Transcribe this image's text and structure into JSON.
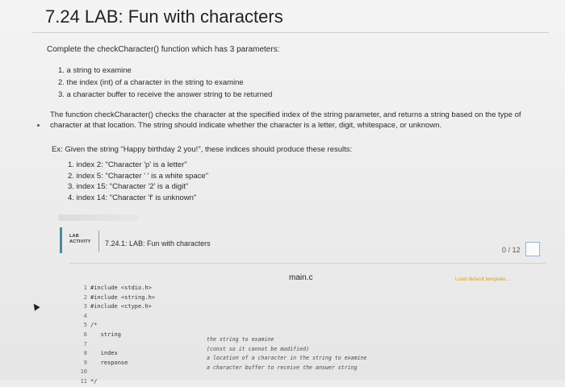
{
  "page_title": "7.24 LAB: Fun with characters",
  "instructions": {
    "intro": "Complete the checkCharacter() function which has 3 parameters:",
    "parameters": [
      "1. a string to examine",
      "2. the index (int) of a character in the string to examine",
      "3. a character buffer to receive the answer string to be returned"
    ],
    "description_lines": [
      "The function checkCharacter() checks the character at the specified index of the string parameter, and returns a string based on the type of",
      "character at that location. The string should indicate whether the character is a letter, digit, whitespace, or unknown."
    ],
    "example_intro": "Ex: Given the string \"Happy birthday 2 you!\", these indices should produce these results:",
    "examples": [
      "1. index 2: \"Character 'p' is a letter\"",
      "2. index 5: \"Character ' ' is a white space\"",
      "3. index 15: \"Character '2' is a digit\"",
      "4. index 14: \"Character 'f' is unknown\""
    ]
  },
  "activity": {
    "tag_line1": "LAB",
    "tag_line2": "ACTIVITY",
    "title": "7.24.1: LAB: Fun with characters",
    "score": "0 / 12",
    "filename": "main.c",
    "load_template_label": "Load default template..."
  },
  "code": {
    "lines": [
      {
        "num": "1",
        "text": "#include <stdio.h>"
      },
      {
        "num": "2",
        "text": "#include <string.h>"
      },
      {
        "num": "3",
        "text": "#include <ctype.h>"
      },
      {
        "num": "4",
        "text": ""
      },
      {
        "num": "5",
        "text": "/*"
      },
      {
        "num": "6",
        "text": "   string"
      },
      {
        "num": "7",
        "text": ""
      },
      {
        "num": "8",
        "text": "   index"
      },
      {
        "num": "9",
        "text": "   response"
      },
      {
        "num": "10",
        "text": ""
      },
      {
        "num": "11",
        "text": "*/"
      }
    ],
    "comment_lines": [
      "the string to examine",
      "(const so it cannot be modified)",
      "a location of a character in the string to examine",
      "a character buffer to receive the answer string"
    ]
  }
}
